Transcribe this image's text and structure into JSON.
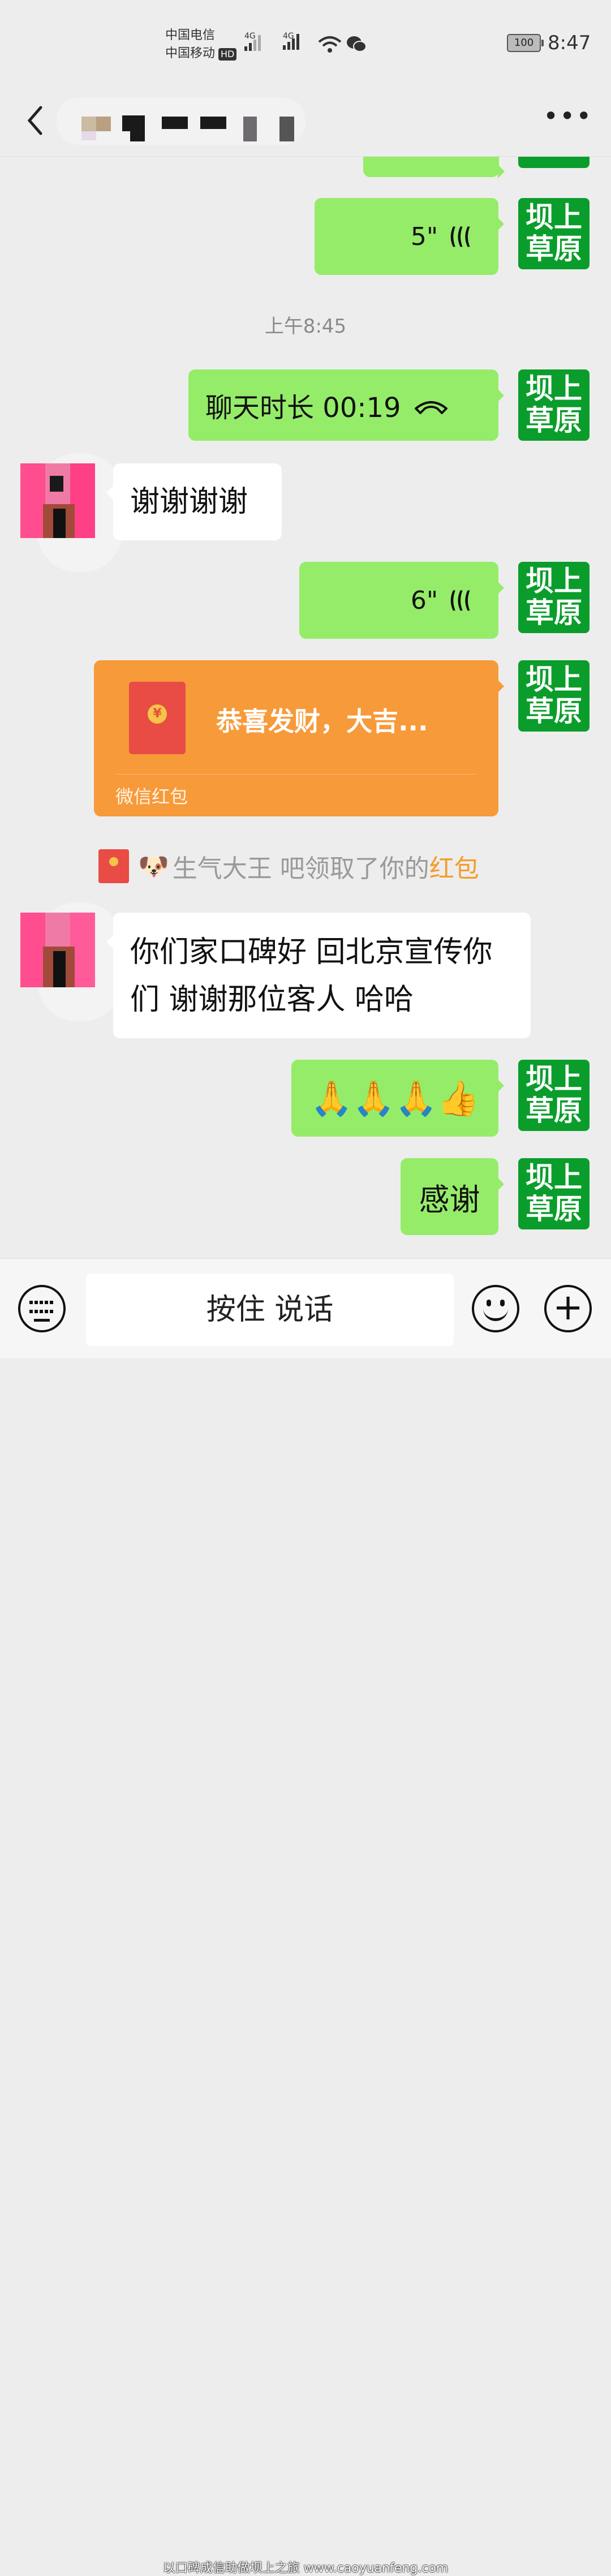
{
  "status_bar": {
    "carrier1": "中国电信",
    "carrier2": "中国移动",
    "hd": "HD",
    "net1": "4G",
    "net2": "4G",
    "battery": "100",
    "time": "8:47"
  },
  "header": {
    "title": "",
    "back_icon": "chevron-left-icon",
    "more_icon": "more-dots-icon",
    "more_label": "•••"
  },
  "me": {
    "avatar_text": "坝上\n草原",
    "avatar_color": "#0a9d2b"
  },
  "messages": {
    "voice1_duration": "5\"",
    "timestamp": "上午8:45",
    "call_text": "聊天时长 00:19",
    "other_text1": "谢谢谢谢",
    "voice2_duration": "6\"",
    "red_packet": {
      "title": "恭喜发财，大吉...",
      "label": "微信红包"
    },
    "system": {
      "prefix": "生气大王 吧领取了你的",
      "highlight": "红包"
    },
    "other_text2": "你们家口碑好 回北京宣传你们 谢谢那位客人 哈哈",
    "emoji_message": "🙏🙏🙏👍",
    "me_text_last": "感谢"
  },
  "input_bar": {
    "hold_to_talk": "按住 说话",
    "watermark": "以口碑成信助做坝上之旅 www.caoyuanfeng.com"
  },
  "colors": {
    "me_bubble": "#95ec69",
    "other_bubble": "#ffffff",
    "red_packet": "#f79a3a",
    "highlight": "#f39c2b"
  }
}
